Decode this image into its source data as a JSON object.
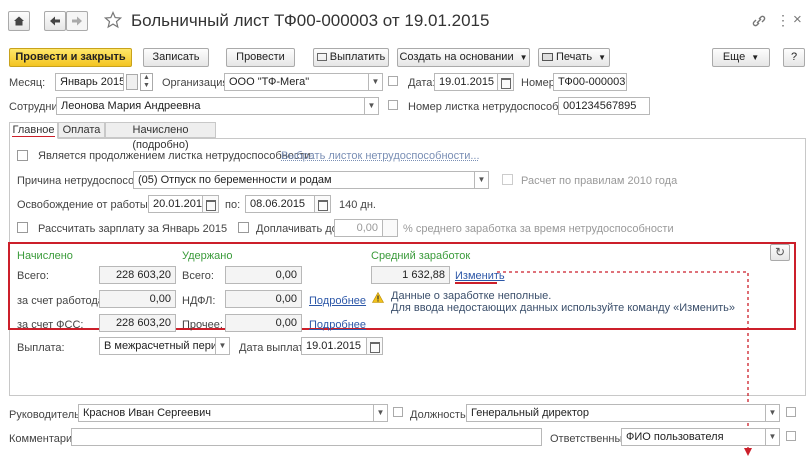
{
  "title": "Больничный лист ТФ00-000003 от 19.01.2015",
  "toolbar": {
    "post_close": "Провести и закрыть",
    "save": "Записать",
    "post": "Провести",
    "pay": "Выплатить",
    "create_basis": "Создать на основании",
    "print": "Печать",
    "more": "Еще",
    "help": "?"
  },
  "header": {
    "month_label": "Месяц:",
    "month_value": "Январь 2015",
    "org_label": "Организация:",
    "org_value": "ООО \"ТФ-Мега\"",
    "date_label": "Дата:",
    "date_value": "19.01.2015",
    "number_label": "Номер:",
    "number_value": "ТФ00-000003",
    "employee_label": "Сотрудник:",
    "employee_value": "Леонова Мария Андреевна",
    "sheet_number_label": "Номер листка нетрудоспособности:",
    "sheet_number_value": "001234567895"
  },
  "tabs": [
    "Главное",
    "Оплата",
    "Начислено (подробно)"
  ],
  "main": {
    "continuation_label": "Является продолжением листка нетрудоспособности:",
    "choose_sheet_link": "Выбрать листок нетрудоспособности...",
    "reason_label": "Причина нетрудоспособн.:",
    "reason_value": "(05) Отпуск по беременности и родам",
    "rules2010_label": "Расчет по правилам 2010 года",
    "release_label": "Освобождение от работы с:",
    "release_from": "20.01.2015",
    "to_label": "по:",
    "release_to": "08.06.2015",
    "days_text": "140 дн.",
    "calc_salary_label": "Рассчитать зарплату за Январь 2015",
    "pay_up_to_label": "Доплачивать до",
    "pay_up_to_value": "0,00",
    "avg_percent_label": "% среднего заработка за время нетрудоспособности"
  },
  "calc": {
    "accrued_header": "Начислено",
    "total_label": "Всего:",
    "total_value": "228 603,20",
    "employer_label": "за счет работодат.:",
    "employer_value": "0,00",
    "fss_label": "за счет ФСС:",
    "fss_value": "228 603,20",
    "withheld_header": "Удержано",
    "withheld_total_label": "Всего:",
    "withheld_total_value": "0,00",
    "ndfl_label": "НДФЛ:",
    "ndfl_value": "0,00",
    "more_link1": "Подробнее",
    "other_label": "Прочее:",
    "other_value": "0,00",
    "more_link2": "Подробнее",
    "avg_header": "Средний заработок",
    "avg_value": "1 632,88",
    "change_link": "Изменить",
    "warn_line1": "Данные о заработке неполные.",
    "warn_line2": "Для ввода недостающих данных используйте команду «Изменить»"
  },
  "payout": {
    "label": "Выплата:",
    "value": "В межрасчетный период",
    "date_label": "Дата выплаты:",
    "date_value": "19.01.2015"
  },
  "footer": {
    "head_label": "Руководитель:",
    "head_value": "Краснов Иван Сергеевич",
    "position_label": "Должность:",
    "position_value": "Генеральный директор",
    "comment_label": "Комментарий:",
    "comment_value": "",
    "responsible_label": "Ответственный:",
    "responsible_value": "ФИО пользователя"
  },
  "colors": {
    "highlight_border": "#cc1f2a",
    "green_header": "#3a9b3a",
    "link": "#2c57a8",
    "primary_button": "#f3c421"
  }
}
